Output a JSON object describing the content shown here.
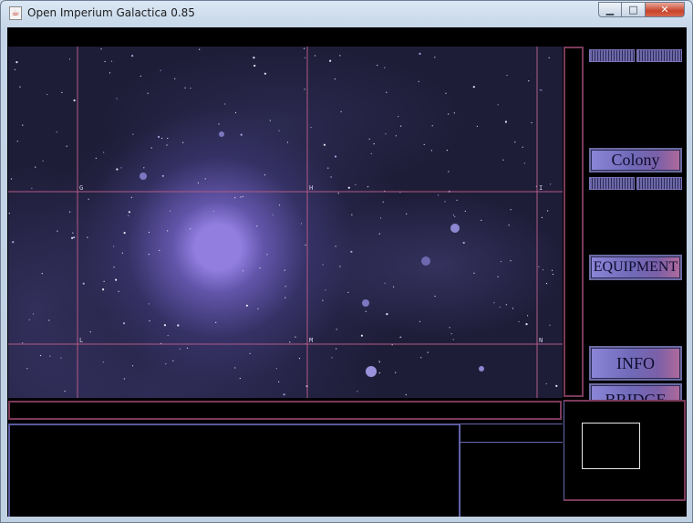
{
  "window": {
    "title": "Open Imperium Galactica 0.85",
    "icon": "java-cup-icon",
    "controls": {
      "minimize": "▁",
      "maximize": "□",
      "close": "✕"
    }
  },
  "starmap": {
    "grid_labels": [
      "G",
      "H",
      "I",
      "L",
      "M",
      "N"
    ]
  },
  "panel": {
    "colony": "Colony",
    "equipment": "EQUIPMENT",
    "info": "INFO",
    "bridge": "BRIDGE"
  },
  "colors": {
    "grid_line": "#b05a86",
    "panel_border": "#7a3a5a",
    "button_gradient_start": "#8b86d8",
    "button_gradient_end": "#b06a9a"
  }
}
